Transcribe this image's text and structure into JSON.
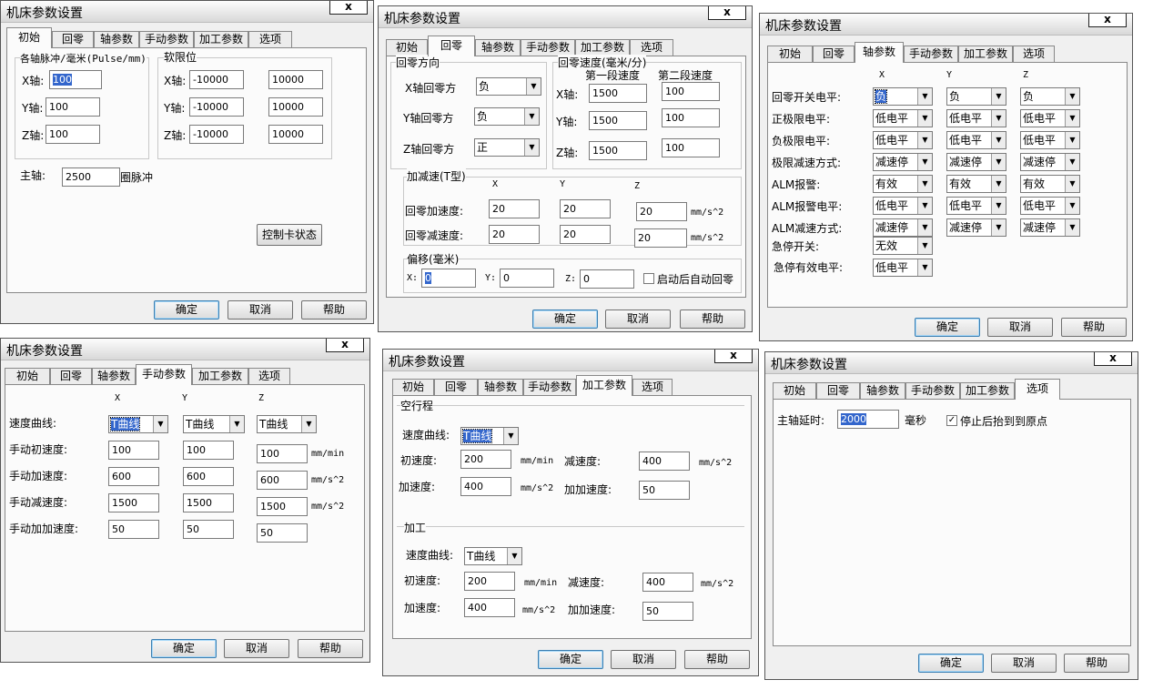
{
  "dialog": {
    "title": "机床参数设置",
    "close": "x",
    "ok": "确定",
    "cancel": "取消",
    "help": "帮助"
  },
  "tabs": [
    "初始",
    "回零",
    "轴参数",
    "手动参数",
    "加工参数",
    "选项"
  ],
  "init": {
    "pulse_group": "各轴脉冲/毫米(Pulse/mm)",
    "soft_group": "软限位",
    "x_label": "X轴:",
    "y_label": "Y轴:",
    "z_label": "Z轴:",
    "x_pulse": "100",
    "y_pulse": "100",
    "z_pulse": "100",
    "x_min": "-10000",
    "x_max": "10000",
    "y_min": "-10000",
    "y_max": "10000",
    "z_min": "-10000",
    "z_max": "10000",
    "spindle_label": "主轴:",
    "spindle_value": "2500",
    "spindle_unit": "圈脉冲",
    "card_status": "控制卡状态"
  },
  "home": {
    "dir_group": "回零方向",
    "speed_group": "回零速度(毫米/分)",
    "first_speed": "第一段速度",
    "second_speed": "第二段速度",
    "x_dir_label": "X轴回零方",
    "y_dir_label": "Y轴回零方",
    "z_dir_label": "Z轴回零方",
    "x_dir": "负",
    "y_dir": "负",
    "z_dir": "正",
    "x_label": "X轴:",
    "y_label": "Y轴:",
    "z_label": "Z轴:",
    "x_s1": "1500",
    "x_s2": "100",
    "y_s1": "1500",
    "y_s2": "100",
    "z_s1": "1500",
    "z_s2": "100",
    "acc_group": "加减速(T型)",
    "col_x": "X",
    "col_y": "Y",
    "col_z": "Z",
    "acc_label": "回零加速度:",
    "dec_label": "回零减速度:",
    "acc_x": "20",
    "acc_y": "20",
    "acc_z": "20",
    "dec_x": "20",
    "dec_y": "20",
    "dec_z": "20",
    "unit": "mm/s^2",
    "offset_group": "偏移(毫米)",
    "off_x_label": "X:",
    "off_y_label": "Y:",
    "off_z_label": "Z:",
    "off_x": "0",
    "off_y": "0",
    "off_z": "0",
    "auto_home": "启动后自动回零"
  },
  "axis": {
    "col_x": "X",
    "col_y": "Y",
    "col_z": "Z",
    "rows": [
      {
        "label": "回零开关电平:",
        "values": [
          "负",
          "负",
          "负"
        ]
      },
      {
        "label": "正极限电平:",
        "values": [
          "低电平",
          "低电平",
          "低电平"
        ]
      },
      {
        "label": "负极限电平:",
        "values": [
          "低电平",
          "低电平",
          "低电平"
        ]
      },
      {
        "label": "极限减速方式:",
        "values": [
          "减速停",
          "减速停",
          "减速停"
        ]
      },
      {
        "label": "ALM报警:",
        "values": [
          "有效",
          "有效",
          "有效"
        ]
      },
      {
        "label": "ALM报警电平:",
        "values": [
          "低电平",
          "低电平",
          "低电平"
        ]
      },
      {
        "label": "ALM减速方式:",
        "values": [
          "减速停",
          "减速停",
          "减速停"
        ]
      }
    ],
    "estop_label": "急停开关:",
    "estop_value": "无效",
    "estop_level_label": "急停有效电平:",
    "estop_level_value": "低电平"
  },
  "manual": {
    "col_x": "X",
    "col_y": "Y",
    "col_z": "Z",
    "curve_label": "速度曲线:",
    "curve_x": "T曲线",
    "curve_y": "T曲线",
    "curve_z": "T曲线",
    "rows": [
      {
        "label": "手动初速度:",
        "values": [
          "100",
          "100",
          "100"
        ],
        "unit": "mm/min"
      },
      {
        "label": "手动加速度:",
        "values": [
          "600",
          "600",
          "600"
        ],
        "unit": "mm/s^2"
      },
      {
        "label": "手动减速度:",
        "values": [
          "1500",
          "1500",
          "1500"
        ],
        "unit": "mm/s^2"
      },
      {
        "label": "手动加加速度:",
        "values": [
          "50",
          "50",
          "50"
        ],
        "unit": ""
      }
    ]
  },
  "process": {
    "idle_group": "空行程",
    "work_group": "加工",
    "curve_label": "速度曲线:",
    "idle_curve": "T曲线",
    "work_curve": "T曲线",
    "init_label": "初速度:",
    "dec_label": "减速度:",
    "acc_label": "加速度:",
    "jerk_label": "加加速度:",
    "idle_init": "200",
    "idle_dec": "400",
    "idle_acc": "400",
    "idle_jerk": "50",
    "work_init": "200",
    "work_dec": "400",
    "work_acc": "400",
    "work_jerk": "50",
    "unit_min": "mm/min",
    "unit_s2": "mm/s^2"
  },
  "options": {
    "delay_label": "主轴延时:",
    "delay_value": "2000",
    "delay_unit": "毫秒",
    "return_origin": "停止后抬到到原点"
  }
}
